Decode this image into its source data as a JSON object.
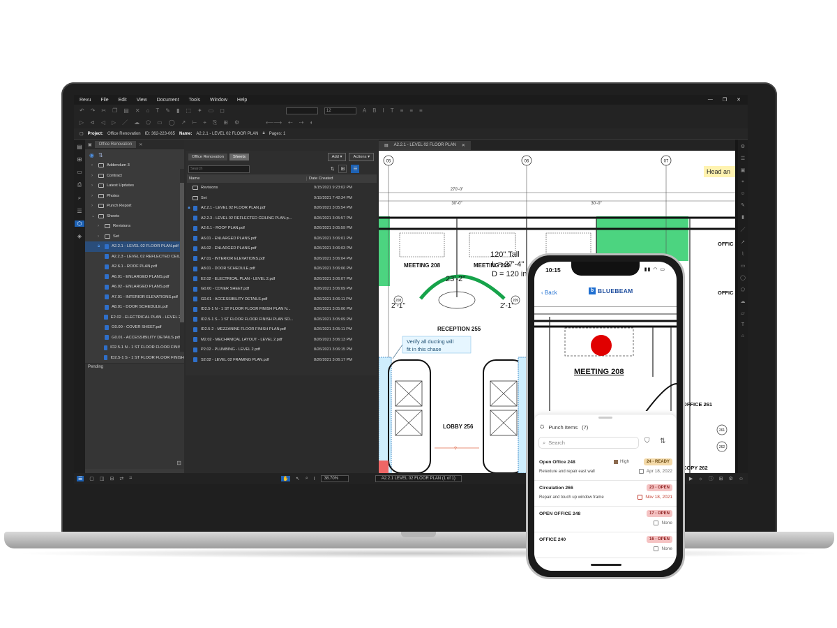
{
  "app": {
    "menus": [
      "Revu",
      "File",
      "Edit",
      "View",
      "Document",
      "Tools",
      "Window",
      "Help"
    ],
    "font_size_value": "12",
    "project_label": "Project:",
    "project_name": "Office Renovation",
    "id_label": "ID: 362-223-065",
    "name_label": "Name:",
    "doc_name": "A2.2.1 - LEVEL 02 FLOOR PLAN",
    "pages_label": "Pages: 1",
    "window_controls": [
      "—",
      "❐",
      "✕"
    ]
  },
  "tree": {
    "tab_label": "Office Renovation",
    "items": [
      {
        "label": "Addendum 3",
        "type": "folder",
        "indent": 1,
        "chev": "›"
      },
      {
        "label": "Contract",
        "type": "folder",
        "indent": 1,
        "chev": "›"
      },
      {
        "label": "Latest Updates",
        "type": "folder",
        "indent": 1,
        "chev": "›"
      },
      {
        "label": "Photos",
        "type": "folder",
        "indent": 1,
        "chev": "›"
      },
      {
        "label": "Punch Report",
        "type": "folder",
        "indent": 1,
        "chev": "›"
      },
      {
        "label": "Sheets",
        "type": "folder",
        "indent": 1,
        "chev": "⌄"
      },
      {
        "label": "Revisions",
        "type": "folder",
        "indent": 2,
        "chev": "›"
      },
      {
        "label": "Set",
        "type": "folder",
        "indent": 2,
        "chev": "›"
      },
      {
        "label": "A2.2.1 - LEVEL 02 FLOOR PLAN.pdf",
        "type": "pdf",
        "indent": 2,
        "selected": true
      },
      {
        "label": "A2.2.3 - LEVEL 02 REFLECTED CEILIN",
        "type": "pdf",
        "indent": 2
      },
      {
        "label": "A2.6.1 - ROOF PLAN.pdf",
        "type": "pdf",
        "indent": 2
      },
      {
        "label": "A6.01 - ENLARGED PLANS.pdf",
        "type": "pdf",
        "indent": 2
      },
      {
        "label": "A6.02 - ENLARGED PLANS.pdf",
        "type": "pdf",
        "indent": 2
      },
      {
        "label": "A7.01 - INTERIOR ELEVATIONS.pdf",
        "type": "pdf",
        "indent": 2
      },
      {
        "label": "A8.01 - DOOR SCHEDULE.pdf",
        "type": "pdf",
        "indent": 2
      },
      {
        "label": "E2.02 - ELECTRICAL PLAN - LEVEL 2.p",
        "type": "pdf",
        "indent": 2
      },
      {
        "label": "G0.00 - COVER SHEET.pdf",
        "type": "pdf",
        "indent": 2
      },
      {
        "label": "G0.01 - ACCESSIBILITY DETAILS.pdf",
        "type": "pdf",
        "indent": 2
      },
      {
        "label": "ID2.5-1 N - 1 ST FLOOR FLOOR FINISH",
        "type": "pdf",
        "indent": 2
      },
      {
        "label": "ID2.5-1 S - 1 ST FLOOR FLOOR FINISH",
        "type": "pdf",
        "indent": 2
      }
    ],
    "pending_label": "Pending"
  },
  "files": {
    "crumbs": [
      "Office Renovation",
      "Sheets"
    ],
    "add_label": "Add",
    "actions_label": "Actions",
    "search_placeholder": "Search",
    "col_name": "Name",
    "col_date": "Date Created",
    "rows": [
      {
        "name": "Revisions",
        "date": "9/15/2021 9:23:02 PM",
        "type": "folder"
      },
      {
        "name": "Set",
        "date": "9/15/2021 7:42:34 PM",
        "type": "folder"
      },
      {
        "name": "A2.2.1 - LEVEL 02 FLOOR PLAN.pdf",
        "date": "8/26/2021 3:05:54 PM",
        "type": "pdf",
        "locked": true
      },
      {
        "name": "A2.2.3 - LEVEL 02 REFLECTED CEILING PLAN.p...",
        "date": "8/26/2021 3:05:57 PM",
        "type": "pdf"
      },
      {
        "name": "A2.6.1 - ROOF PLAN.pdf",
        "date": "8/26/2021 3:05:59 PM",
        "type": "pdf"
      },
      {
        "name": "A6.01 - ENLARGED PLANS.pdf",
        "date": "8/26/2021 3:06:01 PM",
        "type": "pdf"
      },
      {
        "name": "A6.02 - ENLARGED PLANS.pdf",
        "date": "8/26/2021 3:06:03 PM",
        "type": "pdf"
      },
      {
        "name": "A7.01 - INTERIOR ELEVATIONS.pdf",
        "date": "8/26/2021 3:06:04 PM",
        "type": "pdf"
      },
      {
        "name": "A8.01 - DOOR SCHEDULE.pdf",
        "date": "8/26/2021 3:06:06 PM",
        "type": "pdf"
      },
      {
        "name": "E2.02 - ELECTRICAL PLAN - LEVEL 2.pdf",
        "date": "8/26/2021 3:06:07 PM",
        "type": "pdf"
      },
      {
        "name": "G0.00 - COVER SHEET.pdf",
        "date": "8/26/2021 3:06:09 PM",
        "type": "pdf"
      },
      {
        "name": "G0.01 - ACCESSIBILITY DETAILS.pdf",
        "date": "8/26/2021 3:06:11 PM",
        "type": "pdf"
      },
      {
        "name": "ID2.5-1 N - 1 ST FLOOR FLOOR FINISH PLAN N...",
        "date": "8/26/2021 3:05:06 PM",
        "type": "pdf"
      },
      {
        "name": "ID2.5-1 S - 1 ST FLOOR FLOOR FINISH PLAN SO...",
        "date": "8/26/2021 3:05:09 PM",
        "type": "pdf"
      },
      {
        "name": "ID2.5-2 - MEZZANINE FLOOR FINISH PLAN.pdf",
        "date": "8/26/2021 3:05:11 PM",
        "type": "pdf"
      },
      {
        "name": "M2.02 - MECHANICAL LAYOUT - LEVEL 2.pdf",
        "date": "8/26/2021 3:06:13 PM",
        "type": "pdf"
      },
      {
        "name": "P2.02 - PLUMBING - LEVEL 2.pdf",
        "date": "8/26/2021 3:06:15 PM",
        "type": "pdf"
      },
      {
        "name": "S2.02 - LEVEL 02 FRAMING PLAN.pdf",
        "date": "8/26/2021 3:06:17 PM",
        "type": "pdf"
      }
    ]
  },
  "drawing": {
    "tab_label": "A2.2.1 - LEVEL 02 FLOOR PLAN",
    "grid_labels": [
      "05",
      "06",
      "07"
    ],
    "dim_top": "270'-0\"",
    "dim_a": "30'-0\"",
    "dim_b": "30'-0\"",
    "room_meeting_208": "MEETING  208",
    "room_meeting_209": "MEETING  209",
    "dim_arc": "23'-2\"",
    "dim_tall": "120\" Tall",
    "dim_l": "L = 27'-4\"",
    "dim_d": "D = 120 in",
    "dim_left": "2'-1\"",
    "dim_right": "2'-1\"",
    "tag_208": "208",
    "tag_209": "209",
    "room_reception": "RECEPTION  255",
    "note": [
      "Verify all ducting will",
      "fit in this chase"
    ],
    "room_lobby": "LOBBY  256",
    "lobby_dim": "?",
    "room_office_a": "OFFIC",
    "room_office_b": "OFFIC",
    "room_office_261": "OFFICE  261",
    "room_copy": "COPY  262",
    "tag_261": "261",
    "tag_262": "262",
    "head_note": "Head an",
    "zoom": "38.70%",
    "page_indicator": "A2.2.1 LEVEL 02 FLOOR PLAN (1 of 1)"
  },
  "phone": {
    "time": "10:15",
    "back_label": "Back",
    "brand": "BLUEBEAM",
    "room_label": "MEETING  208",
    "panel_title": "Punch Items",
    "count": "(7)",
    "search_placeholder": "Search",
    "items": [
      {
        "title": "Open Office 248",
        "desc": "Retexture and repair east wall",
        "badge": "24 - READY",
        "badge_bg": "#f3d9a8",
        "badge_fg": "#6b4a12",
        "priority": "High",
        "date": "Apr 18, 2022",
        "date_red": false
      },
      {
        "title": "Circulation 266",
        "desc": "Repair and touch up window frame",
        "badge": "23 - OPEN",
        "badge_bg": "#f5c3c3",
        "badge_fg": "#8e1f1f",
        "date": "Nov 18, 2021",
        "date_red": true
      },
      {
        "title": "OPEN OFFICE 248",
        "desc": "",
        "badge": "17 - OPEN",
        "badge_bg": "#f5c3c3",
        "badge_fg": "#8e1f1f",
        "date": "None",
        "date_red": false
      },
      {
        "title": "OFFICE 240",
        "desc": "",
        "badge": "16 - OPEN",
        "badge_bg": "#f5c3c3",
        "badge_fg": "#8e1f1f",
        "date": "None",
        "date_red": false
      }
    ]
  },
  "colors": {
    "accent": "#1e62b4",
    "green_zone": "#4cd480",
    "marker_red": "#e00000",
    "brand_blue": "#1f6fd1"
  }
}
